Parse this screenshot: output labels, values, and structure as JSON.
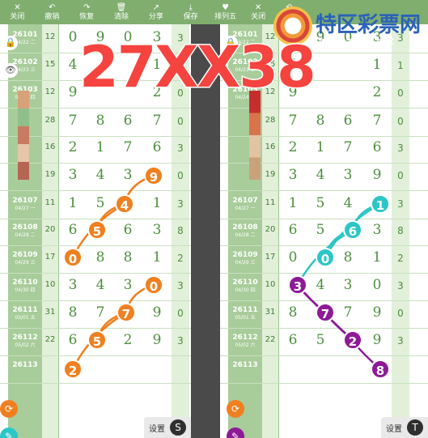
{
  "toolbar": {
    "items": [
      {
        "label": "关闭",
        "icon": "close-icon",
        "glyph": "✕"
      },
      {
        "label": "撤销",
        "icon": "undo-icon",
        "glyph": "↶"
      },
      {
        "label": "恢复",
        "icon": "redo-icon",
        "glyph": "↷"
      },
      {
        "label": "清除",
        "icon": "trash-icon",
        "glyph": "🗑"
      },
      {
        "label": "分享",
        "icon": "share-icon",
        "glyph": "↗"
      },
      {
        "label": "保存",
        "icon": "download-icon",
        "glyph": "⤓"
      },
      {
        "label": "排列五",
        "icon": "heart-icon",
        "glyph": "♥"
      }
    ],
    "close_right_label": "关闭",
    "partial_label": "撤销"
  },
  "overlay": {
    "headline": "27XX38",
    "logo_text": "特区彩票网",
    "logo_url": "www.tqcp.net"
  },
  "rows": [
    {
      "id": "26101",
      "date": "04/22 二",
      "sum": "12",
      "nums": [
        "0",
        "9",
        "0",
        "3"
      ],
      "right": "3"
    },
    {
      "id": "26102",
      "date": "04/23 三",
      "sum": "15",
      "nums": [
        "4",
        "",
        "",
        "1"
      ],
      "right": "1"
    },
    {
      "id": "26103",
      "date": "04/24 四",
      "sum": "12",
      "nums": [
        "9",
        "",
        "",
        "2"
      ],
      "right": "0"
    },
    {
      "id": "",
      "date": "",
      "sum": "28",
      "nums": [
        "7",
        "8",
        "6",
        "7"
      ],
      "right": "0"
    },
    {
      "id": "",
      "date": "",
      "sum": "16",
      "nums": [
        "2",
        "1",
        "7",
        "6"
      ],
      "right": "3"
    },
    {
      "id": "",
      "date": "",
      "sum": "19",
      "nums": [
        "3",
        "4",
        "3",
        "9"
      ],
      "right": "0"
    },
    {
      "id": "26107",
      "date": "04/27 一",
      "sum": "11",
      "nums": [
        "1",
        "5",
        "4",
        "1"
      ],
      "right": "3"
    },
    {
      "id": "26108",
      "date": "04/28 二",
      "sum": "20",
      "nums": [
        "6",
        "5",
        "6",
        "3"
      ],
      "right": "8"
    },
    {
      "id": "26109",
      "date": "04/29 三",
      "sum": "17",
      "nums": [
        "0",
        "8",
        "8",
        "1"
      ],
      "right": "2"
    },
    {
      "id": "26110",
      "date": "04/30 四",
      "sum": "10",
      "nums": [
        "3",
        "4",
        "3",
        "0"
      ],
      "right": "3"
    },
    {
      "id": "26111",
      "date": "05/01 五",
      "sum": "31",
      "nums": [
        "8",
        "7",
        "7",
        "9"
      ],
      "right": "0"
    },
    {
      "id": "26112",
      "date": "05/02 六",
      "sum": "22",
      "nums": [
        "6",
        "5",
        "2",
        "9"
      ],
      "right": "3"
    },
    {
      "id": "26113",
      "date": "",
      "sum": "",
      "nums": [
        "",
        "",
        "",
        ""
      ],
      "right": ""
    }
  ],
  "left_balls": [
    {
      "value": "9",
      "color": "#f07f1f"
    },
    {
      "value": "4",
      "color": "#f07f1f"
    },
    {
      "value": "5",
      "color": "#f07f1f"
    },
    {
      "value": "0",
      "color": "#f07f1f"
    },
    {
      "value": "0",
      "color": "#f07f1f"
    },
    {
      "value": "7",
      "color": "#f07f1f"
    },
    {
      "value": "5",
      "color": "#f07f1f"
    },
    {
      "value": "2",
      "color": "#f07f1f"
    }
  ],
  "right_balls": [
    {
      "value": "1",
      "color": "#2cc6c6"
    },
    {
      "value": "6",
      "color": "#2cc6c6"
    },
    {
      "value": "0",
      "color": "#2cc6c6"
    },
    {
      "value": "3",
      "color": "#8e1a98"
    },
    {
      "value": "7",
      "color": "#8e1a98"
    },
    {
      "value": "2",
      "color": "#8e1a98"
    },
    {
      "value": "8",
      "color": "#8e1a98"
    }
  ],
  "bottom": {
    "settings_label": "设置",
    "left_btn": "S",
    "right_btn": "T"
  },
  "colors": {
    "toolbar": "#7fae6f",
    "orange": "#f07f1f",
    "cyan": "#2cc6c6",
    "purple": "#8e1a98",
    "green_text": "#4c8f3c"
  }
}
